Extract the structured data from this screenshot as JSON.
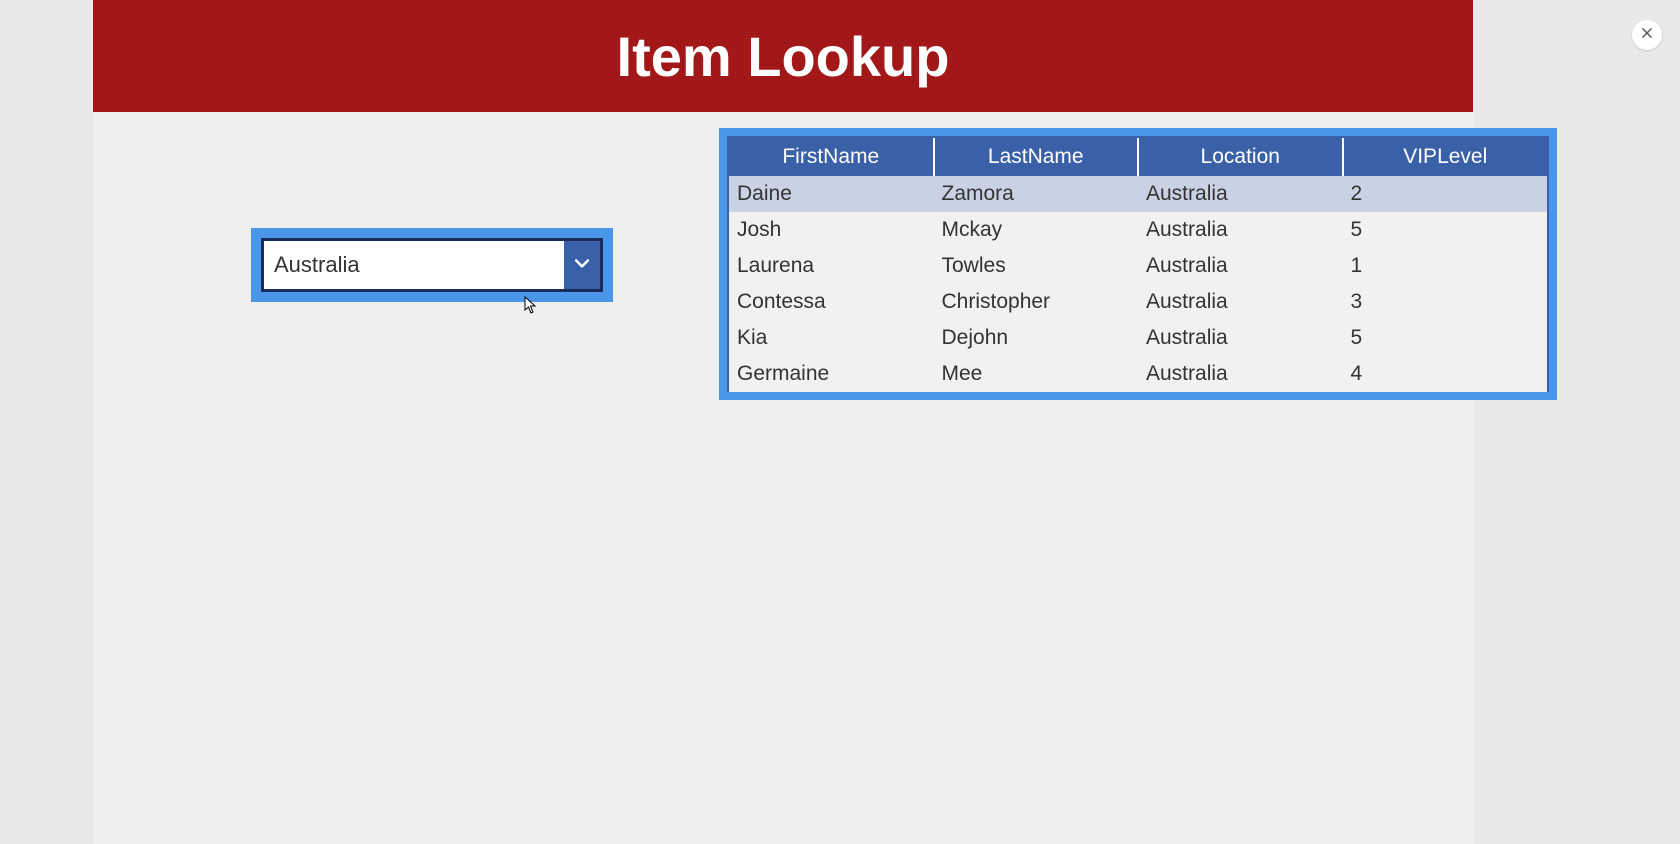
{
  "header": {
    "title": "Item Lookup"
  },
  "dropdown": {
    "selected": "Australia"
  },
  "table": {
    "columns": [
      "FirstName",
      "LastName",
      "Location",
      "VIPLevel"
    ],
    "rows": [
      {
        "FirstName": "Daine",
        "LastName": "Zamora",
        "Location": "Australia",
        "VIPLevel": "2",
        "selected": true
      },
      {
        "FirstName": "Josh",
        "LastName": "Mckay",
        "Location": "Australia",
        "VIPLevel": "5",
        "selected": false
      },
      {
        "FirstName": "Laurena",
        "LastName": "Towles",
        "Location": "Australia",
        "VIPLevel": "1",
        "selected": false
      },
      {
        "FirstName": "Contessa",
        "LastName": "Christopher",
        "Location": "Australia",
        "VIPLevel": "3",
        "selected": false
      },
      {
        "FirstName": "Kia",
        "LastName": "Dejohn",
        "Location": "Australia",
        "VIPLevel": "5",
        "selected": false
      },
      {
        "FirstName": "Germaine",
        "LastName": "Mee",
        "Location": "Australia",
        "VIPLevel": "4",
        "selected": false
      }
    ]
  }
}
